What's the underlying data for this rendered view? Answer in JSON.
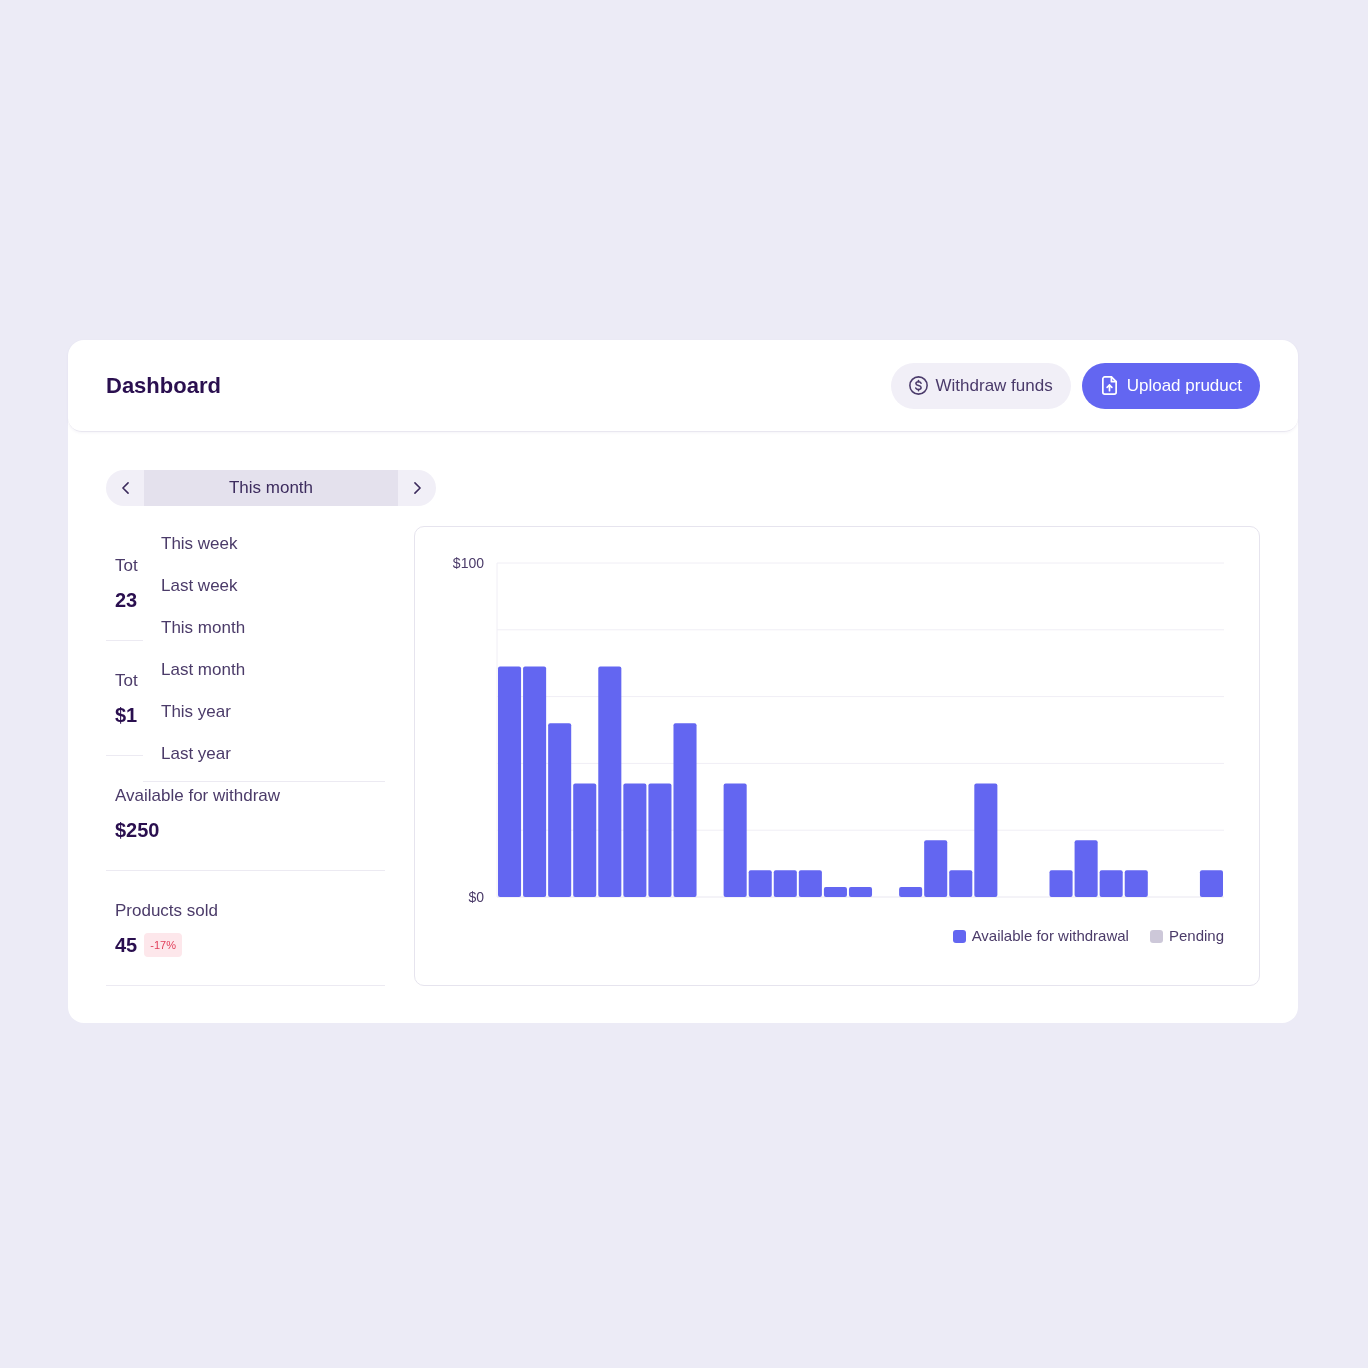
{
  "header": {
    "title": "Dashboard",
    "buttons": [
      {
        "label": "Withdraw funds",
        "kind": "secondary"
      },
      {
        "label": "Upload pruduct",
        "kind": "primary"
      }
    ]
  },
  "period_selector": {
    "value": "This month",
    "expanded": true,
    "options": [
      "This week",
      "Last week",
      "This month",
      "Last month",
      "This year",
      "Last year"
    ]
  },
  "stats": [
    {
      "label": "Tot",
      "value": "23"
    },
    {
      "label": "Tot",
      "value": "$1"
    },
    {
      "label": "Available for withdraw",
      "value": "$250"
    },
    {
      "label": "Products sold",
      "value": "45",
      "badge": "-17%"
    }
  ],
  "chart": {
    "chart_data": {
      "type": "bar",
      "stacked": true,
      "ylim": [
        0,
        100
      ],
      "yticks": [
        {
          "value": 0,
          "label": "$0"
        },
        {
          "value": 100,
          "label": "$100"
        }
      ],
      "series": [
        {
          "name": "Available for withdrawal",
          "color": "#6366f1",
          "values": [
            69,
            69,
            52,
            34,
            69,
            34,
            34,
            52,
            0,
            34,
            8,
            8,
            8,
            3,
            3,
            0,
            3,
            17,
            8,
            34,
            0,
            0,
            8,
            17,
            8,
            8,
            0,
            0,
            8
          ]
        },
        {
          "name": "Pending",
          "color": "#cdc8d9",
          "values": [
            0,
            0,
            0,
            0,
            0,
            0,
            0,
            0,
            0,
            0,
            0,
            0,
            0,
            0,
            0,
            0,
            0,
            0,
            0,
            0,
            0,
            0,
            0,
            0,
            0,
            0,
            0,
            0,
            0
          ]
        }
      ]
    }
  }
}
